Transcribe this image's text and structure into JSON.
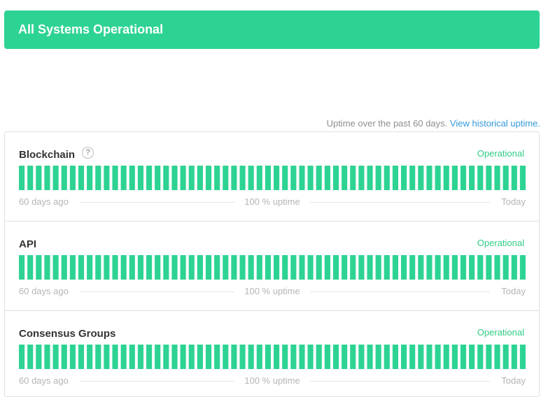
{
  "colors": {
    "operational": "#2dd393",
    "status_text": "#2fcc86",
    "link": "#3498db"
  },
  "banner": {
    "text": "All Systems Operational"
  },
  "uptime_note": {
    "text": "Uptime over the past 60 days.",
    "link_text": "View historical uptime."
  },
  "components": [
    {
      "name": "Blockchain",
      "help": "?",
      "status": "Operational",
      "days": 60,
      "uptime_percent": 100,
      "left_label": "60 days ago",
      "uptime_label": "100 % uptime",
      "right_label": "Today"
    },
    {
      "name": "API",
      "status": "Operational",
      "days": 60,
      "uptime_percent": 100,
      "left_label": "60 days ago",
      "uptime_label": "100 % uptime",
      "right_label": "Today"
    },
    {
      "name": "Consensus Groups",
      "status": "Operational",
      "days": 60,
      "uptime_percent": 100,
      "left_label": "60 days ago",
      "uptime_label": "100 % uptime",
      "right_label": "Today"
    }
  ]
}
